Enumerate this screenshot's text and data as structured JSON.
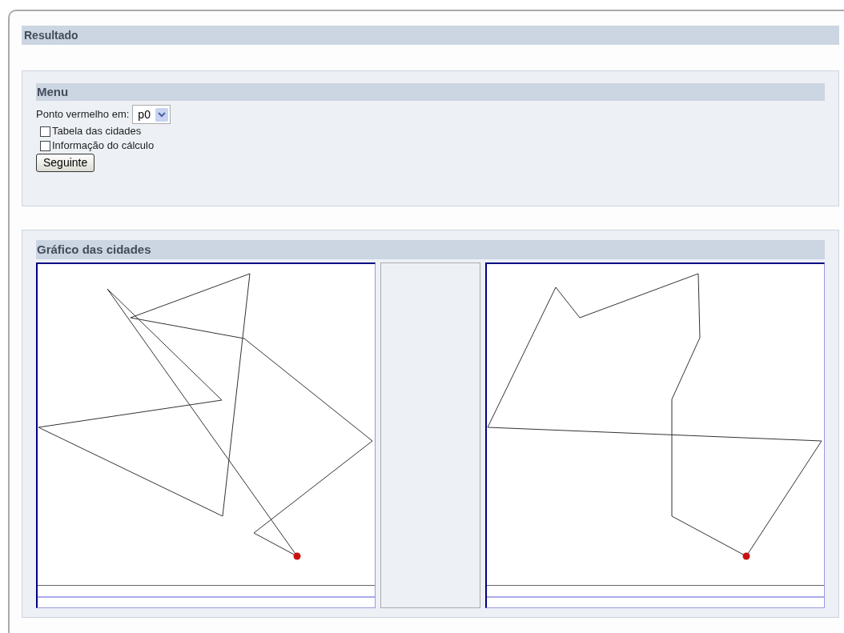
{
  "title": "Resultado",
  "menu": {
    "title": "Menu",
    "select_label": "Ponto vermelho em:",
    "select_value": "p0",
    "checkboxes": [
      {
        "label": "Tabela das cidades",
        "checked": false
      },
      {
        "label": "Informação do cálculo",
        "checked": false
      }
    ],
    "button": "Seguinte"
  },
  "graph": {
    "title": "Gráfico das cidades"
  }
}
